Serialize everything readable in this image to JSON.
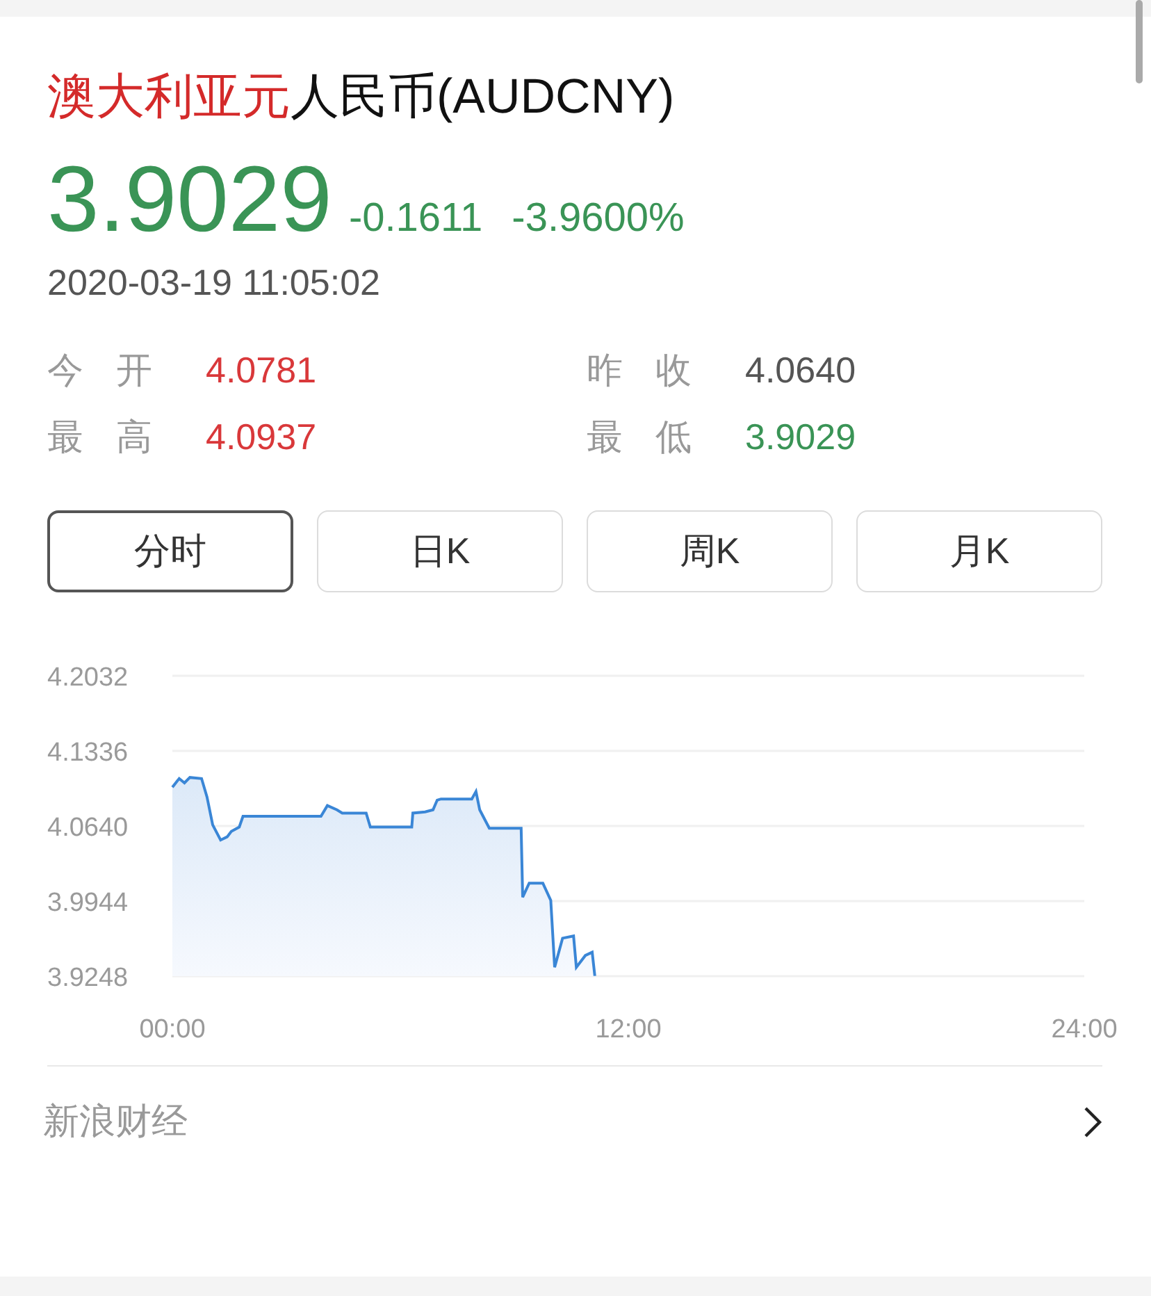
{
  "title": {
    "base": "澳大利亚元",
    "quote": "人民币(AUDCNY)"
  },
  "quote": {
    "price": "3.9029",
    "change": "-0.1611",
    "change_percent": "-3.9600%",
    "time": "2020-03-19 11:05:02"
  },
  "stats": [
    {
      "label": "今开",
      "value": "4.0781",
      "color": "#d9383a"
    },
    {
      "label": "昨收",
      "value": "4.0640",
      "color": "#555555"
    },
    {
      "label": "最高",
      "value": "4.0937",
      "color": "#d9383a"
    },
    {
      "label": "最低",
      "value": "3.9029",
      "color": "#3a9456"
    }
  ],
  "tabs": [
    {
      "label": "分时",
      "selected": true
    },
    {
      "label": "日K",
      "selected": false
    },
    {
      "label": "周K",
      "selected": false
    },
    {
      "label": "月K",
      "selected": false
    }
  ],
  "chart_data": {
    "type": "area",
    "x": [
      0,
      0.18,
      0.32,
      0.46,
      0.77,
      0.91,
      1.06,
      1.27,
      1.44,
      1.55,
      1.76,
      1.86,
      3.91,
      4.08,
      4.33,
      4.47,
      5.1,
      5.21,
      6.3,
      6.33,
      6.65,
      6.86,
      6.97,
      7.07,
      7.88,
      7.99,
      8.09,
      8.34,
      9.18,
      9.22,
      9.39,
      9.75,
      9.96,
      10.06,
      10.27,
      10.56,
      10.63,
      10.87,
      11.05,
      11.12
    ],
    "grid": true,
    "series": [
      {
        "color": "#3a86d6",
        "values": [
          4.1,
          4.108,
          4.104,
          4.109,
          4.108,
          4.091,
          4.065,
          4.051,
          4.054,
          4.059,
          4.063,
          4.073,
          4.073,
          4.083,
          4.079,
          4.076,
          4.076,
          4.063,
          4.063,
          4.076,
          4.077,
          4.079,
          4.088,
          4.089,
          4.089,
          4.096,
          4.079,
          4.062,
          4.062,
          3.998,
          4.011,
          4.011,
          3.995,
          3.933,
          3.96,
          3.962,
          3.933,
          3.944,
          3.947,
          3.925
        ]
      }
    ],
    "xlim": [
      0,
      24
    ],
    "ylim": [
      3.9248,
      4.2032
    ],
    "xticks": [
      {
        "value": 0,
        "label": "00:00"
      },
      {
        "value": 12,
        "label": "12:00"
      },
      {
        "value": 24,
        "label": "24:00"
      }
    ],
    "yticks": [
      {
        "value": 4.2032,
        "label": "4.2032"
      },
      {
        "value": 4.1336,
        "label": "4.1336"
      },
      {
        "value": 4.064,
        "label": "4.0640"
      },
      {
        "value": 3.9944,
        "label": "3.9944"
      },
      {
        "value": 3.9248,
        "label": "3.9248"
      }
    ]
  },
  "footer": {
    "source": "新浪财经"
  }
}
